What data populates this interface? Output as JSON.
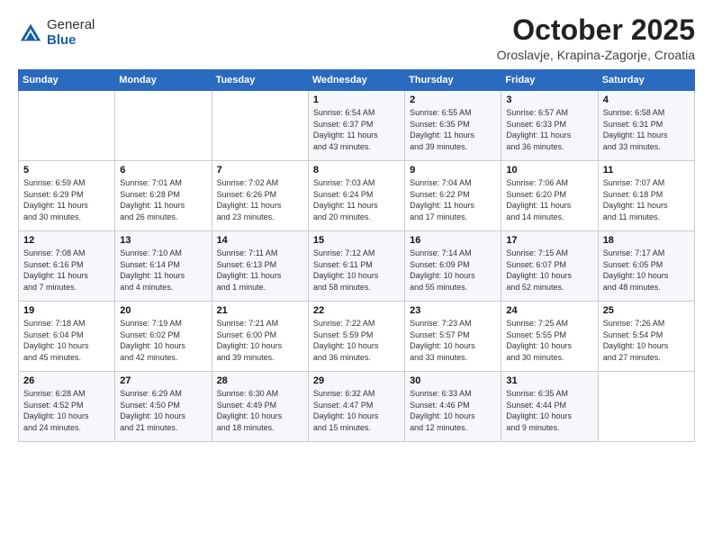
{
  "header": {
    "logo_general": "General",
    "logo_blue": "Blue",
    "title": "October 2025",
    "location": "Oroslavje, Krapina-Zagorje, Croatia"
  },
  "days_of_week": [
    "Sunday",
    "Monday",
    "Tuesday",
    "Wednesday",
    "Thursday",
    "Friday",
    "Saturday"
  ],
  "weeks": [
    [
      {
        "day": "",
        "info": ""
      },
      {
        "day": "",
        "info": ""
      },
      {
        "day": "",
        "info": ""
      },
      {
        "day": "1",
        "info": "Sunrise: 6:54 AM\nSunset: 6:37 PM\nDaylight: 11 hours\nand 43 minutes."
      },
      {
        "day": "2",
        "info": "Sunrise: 6:55 AM\nSunset: 6:35 PM\nDaylight: 11 hours\nand 39 minutes."
      },
      {
        "day": "3",
        "info": "Sunrise: 6:57 AM\nSunset: 6:33 PM\nDaylight: 11 hours\nand 36 minutes."
      },
      {
        "day": "4",
        "info": "Sunrise: 6:58 AM\nSunset: 6:31 PM\nDaylight: 11 hours\nand 33 minutes."
      }
    ],
    [
      {
        "day": "5",
        "info": "Sunrise: 6:59 AM\nSunset: 6:29 PM\nDaylight: 11 hours\nand 30 minutes."
      },
      {
        "day": "6",
        "info": "Sunrise: 7:01 AM\nSunset: 6:28 PM\nDaylight: 11 hours\nand 26 minutes."
      },
      {
        "day": "7",
        "info": "Sunrise: 7:02 AM\nSunset: 6:26 PM\nDaylight: 11 hours\nand 23 minutes."
      },
      {
        "day": "8",
        "info": "Sunrise: 7:03 AM\nSunset: 6:24 PM\nDaylight: 11 hours\nand 20 minutes."
      },
      {
        "day": "9",
        "info": "Sunrise: 7:04 AM\nSunset: 6:22 PM\nDaylight: 11 hours\nand 17 minutes."
      },
      {
        "day": "10",
        "info": "Sunrise: 7:06 AM\nSunset: 6:20 PM\nDaylight: 11 hours\nand 14 minutes."
      },
      {
        "day": "11",
        "info": "Sunrise: 7:07 AM\nSunset: 6:18 PM\nDaylight: 11 hours\nand 11 minutes."
      }
    ],
    [
      {
        "day": "12",
        "info": "Sunrise: 7:08 AM\nSunset: 6:16 PM\nDaylight: 11 hours\nand 7 minutes."
      },
      {
        "day": "13",
        "info": "Sunrise: 7:10 AM\nSunset: 6:14 PM\nDaylight: 11 hours\nand 4 minutes."
      },
      {
        "day": "14",
        "info": "Sunrise: 7:11 AM\nSunset: 6:13 PM\nDaylight: 11 hours\nand 1 minute."
      },
      {
        "day": "15",
        "info": "Sunrise: 7:12 AM\nSunset: 6:11 PM\nDaylight: 10 hours\nand 58 minutes."
      },
      {
        "day": "16",
        "info": "Sunrise: 7:14 AM\nSunset: 6:09 PM\nDaylight: 10 hours\nand 55 minutes."
      },
      {
        "day": "17",
        "info": "Sunrise: 7:15 AM\nSunset: 6:07 PM\nDaylight: 10 hours\nand 52 minutes."
      },
      {
        "day": "18",
        "info": "Sunrise: 7:17 AM\nSunset: 6:05 PM\nDaylight: 10 hours\nand 48 minutes."
      }
    ],
    [
      {
        "day": "19",
        "info": "Sunrise: 7:18 AM\nSunset: 6:04 PM\nDaylight: 10 hours\nand 45 minutes."
      },
      {
        "day": "20",
        "info": "Sunrise: 7:19 AM\nSunset: 6:02 PM\nDaylight: 10 hours\nand 42 minutes."
      },
      {
        "day": "21",
        "info": "Sunrise: 7:21 AM\nSunset: 6:00 PM\nDaylight: 10 hours\nand 39 minutes."
      },
      {
        "day": "22",
        "info": "Sunrise: 7:22 AM\nSunset: 5:59 PM\nDaylight: 10 hours\nand 36 minutes."
      },
      {
        "day": "23",
        "info": "Sunrise: 7:23 AM\nSunset: 5:57 PM\nDaylight: 10 hours\nand 33 minutes."
      },
      {
        "day": "24",
        "info": "Sunrise: 7:25 AM\nSunset: 5:55 PM\nDaylight: 10 hours\nand 30 minutes."
      },
      {
        "day": "25",
        "info": "Sunrise: 7:26 AM\nSunset: 5:54 PM\nDaylight: 10 hours\nand 27 minutes."
      }
    ],
    [
      {
        "day": "26",
        "info": "Sunrise: 6:28 AM\nSunset: 4:52 PM\nDaylight: 10 hours\nand 24 minutes."
      },
      {
        "day": "27",
        "info": "Sunrise: 6:29 AM\nSunset: 4:50 PM\nDaylight: 10 hours\nand 21 minutes."
      },
      {
        "day": "28",
        "info": "Sunrise: 6:30 AM\nSunset: 4:49 PM\nDaylight: 10 hours\nand 18 minutes."
      },
      {
        "day": "29",
        "info": "Sunrise: 6:32 AM\nSunset: 4:47 PM\nDaylight: 10 hours\nand 15 minutes."
      },
      {
        "day": "30",
        "info": "Sunrise: 6:33 AM\nSunset: 4:46 PM\nDaylight: 10 hours\nand 12 minutes."
      },
      {
        "day": "31",
        "info": "Sunrise: 6:35 AM\nSunset: 4:44 PM\nDaylight: 10 hours\nand 9 minutes."
      },
      {
        "day": "",
        "info": ""
      }
    ]
  ]
}
